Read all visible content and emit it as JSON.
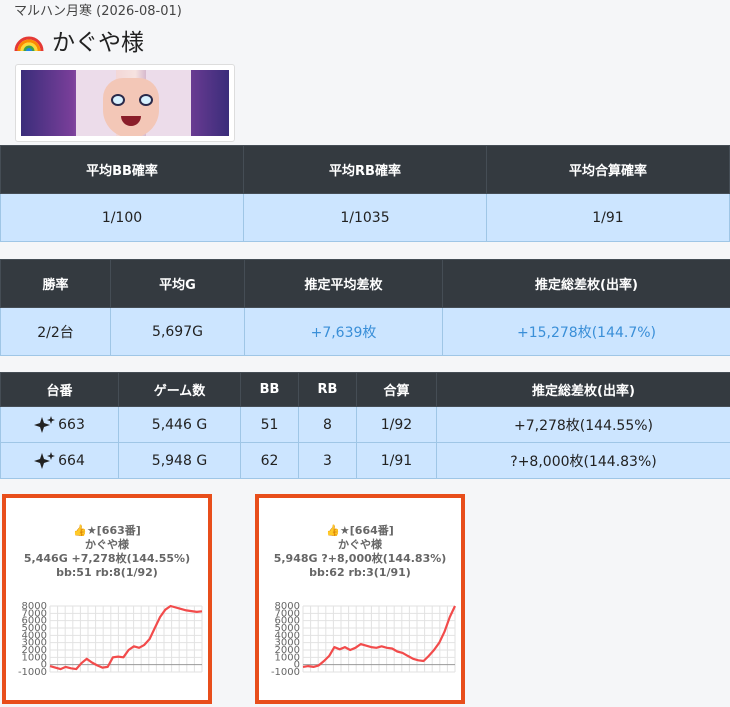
{
  "header": {
    "store_date": "マルハン月寒 (2026-08-01)",
    "name": "かぐや様",
    "rainbow_icon": "rainbow-icon"
  },
  "stats1": {
    "headers": [
      "平均BB確率",
      "平均RB確率",
      "平均合算確率"
    ],
    "values": [
      "1/100",
      "1/1035",
      "1/91"
    ]
  },
  "stats2": {
    "headers": [
      "勝率",
      "平均G",
      "推定平均差枚",
      "推定総差枚(出率)"
    ],
    "values": [
      "2/2台",
      "5,697G",
      "+7,639枚",
      "+15,278枚(144.7%)"
    ]
  },
  "machines": {
    "headers": [
      "台番",
      "ゲーム数",
      "BB",
      "RB",
      "合算",
      "推定総差枚(出率)"
    ],
    "rows": [
      {
        "num": "663",
        "games": "5,446 G",
        "bb": "51",
        "rb": "8",
        "total": "1/92",
        "diff": "+7,278枚(144.55%)"
      },
      {
        "num": "664",
        "games": "5,948 G",
        "bb": "62",
        "rb": "3",
        "total": "1/91",
        "diff": "?+8,000枚(144.83%)"
      }
    ]
  },
  "cards": [
    {
      "line1": "👍★[663番]",
      "line2": "かぐや様",
      "line3": "5,446G +7,278枚(144.55%)",
      "line4": "bb:51 rb:8(1/92)"
    },
    {
      "line1": "👍★[664番]",
      "line2": "かぐや様",
      "line3": "5,948G ?+8,000枚(144.83%)",
      "line4": "bb:62 rb:3(1/91)"
    }
  ],
  "chart_data": [
    {
      "type": "line",
      "ylim": [
        -1000,
        8000
      ],
      "yticks": [
        "8000",
        "7000",
        "6000",
        "5000",
        "4000",
        "3000",
        "2000",
        "1000",
        "0",
        "-1000"
      ],
      "color": "#f24b4b",
      "x": [
        0,
        1,
        2,
        3,
        4,
        5,
        6,
        7,
        8,
        9,
        10,
        11,
        12,
        13,
        14,
        15,
        16,
        17,
        18,
        19,
        20,
        21,
        22,
        23,
        24,
        25,
        26,
        27,
        28,
        29
      ],
      "values": [
        -200,
        -400,
        -600,
        -300,
        -500,
        -600,
        200,
        800,
        300,
        -100,
        -400,
        -300,
        1000,
        1100,
        1000,
        2000,
        2500,
        2300,
        2700,
        3500,
        5000,
        6500,
        7500,
        8000,
        7800,
        7600,
        7400,
        7300,
        7200,
        7278
      ]
    },
    {
      "type": "line",
      "ylim": [
        -1000,
        8000
      ],
      "yticks": [
        "8000",
        "7000",
        "6000",
        "5000",
        "4000",
        "3000",
        "2000",
        "1000",
        "0",
        "-1000"
      ],
      "color": "#f24b4b",
      "x": [
        0,
        1,
        2,
        3,
        4,
        5,
        6,
        7,
        8,
        9,
        10,
        11,
        12,
        13,
        14,
        15,
        16,
        17,
        18,
        19,
        20,
        21,
        22,
        23,
        24,
        25,
        26,
        27,
        28,
        29
      ],
      "values": [
        -300,
        -200,
        -300,
        -100,
        500,
        1200,
        2400,
        2100,
        2400,
        2000,
        2300,
        2800,
        2600,
        2400,
        2300,
        2500,
        2300,
        2200,
        1800,
        1600,
        1200,
        800,
        600,
        500,
        1200,
        2000,
        3000,
        4500,
        6500,
        8000
      ]
    }
  ]
}
